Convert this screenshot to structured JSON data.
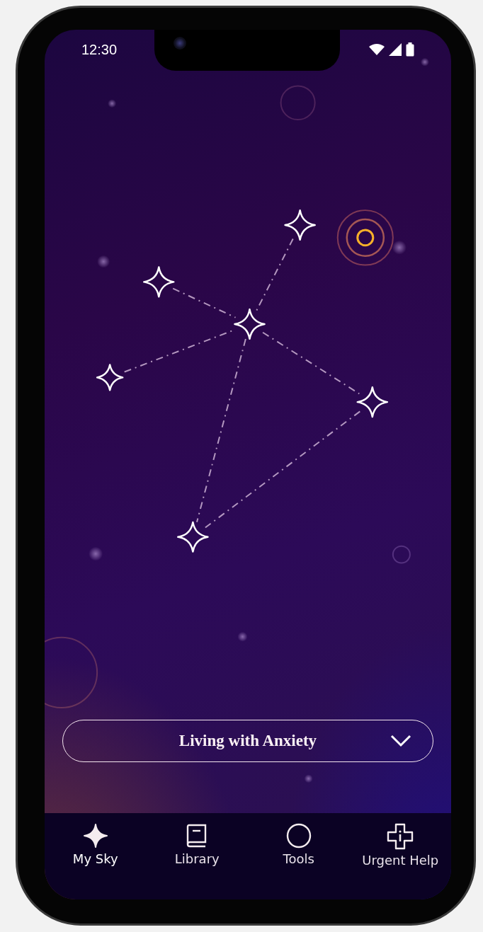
{
  "status_bar": {
    "time": "12:30"
  },
  "topic_selector": {
    "label": "Living with Anxiety",
    "expanded": false
  },
  "nav": [
    {
      "label": "My Sky",
      "kind": "sky",
      "selected": true
    },
    {
      "label": "Library",
      "kind": "library",
      "selected": false
    },
    {
      "label": "Tools",
      "kind": "tools",
      "selected": false
    },
    {
      "label": "Urgent Help",
      "kind": "help",
      "selected": false
    }
  ]
}
